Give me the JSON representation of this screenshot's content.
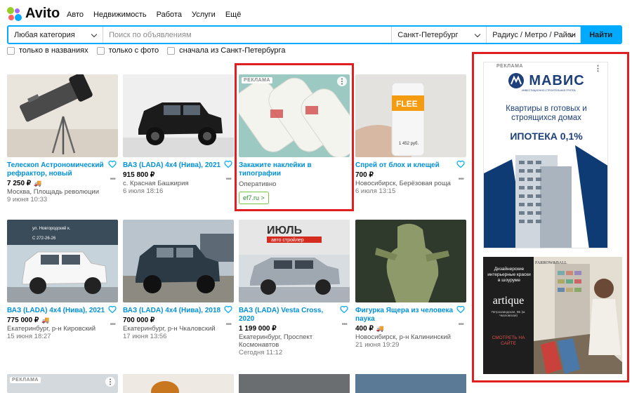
{
  "brand": {
    "name": "Avito"
  },
  "nav": [
    "Авто",
    "Недвижимость",
    "Работа",
    "Услуги",
    "Ещё"
  ],
  "search": {
    "category": "Любая категория",
    "placeholder": "Поиск по объявлениям",
    "city": "Санкт-Петербург",
    "radius": "Радиус / Метро / Район",
    "button": "Найти"
  },
  "filters": [
    "только в названиях",
    "только с фото",
    "сначала из Санкт-Петербурга"
  ],
  "listings": [
    {
      "title": "Телескоп Астрономический рефрактор, новый",
      "price": "7 250 ₽",
      "loc": "Москва, Площадь революции",
      "date": "9 июня 10:33"
    },
    {
      "title": "ВАЗ (LADA) 4x4 (Нива), 2021",
      "price": "915 800 ₽",
      "loc": "с. Красная Башкирия",
      "date": "6 июля 18:16"
    },
    {
      "title": "Спрей от блох и клещей",
      "price": "700 ₽",
      "loc": "Новосибирск, Берёзовая роща",
      "date": "6 июля 13:15"
    },
    {
      "title": "ВАЗ (LADA) 4x4 (Нива), 2021",
      "price": "775 000 ₽",
      "loc": "Екатеринбург, р-н Кировский",
      "date": "15 июня 18:27"
    },
    {
      "title": "ВАЗ (LADA) 4x4 (Нива), 2018",
      "price": "700 000 ₽",
      "loc": "Екатеринбург, р-н Чкаловский",
      "date": "17 июня 13:56"
    },
    {
      "title": "ВАЗ (LADA) Vesta Cross, 2020",
      "price": "1 199 000 ₽",
      "loc": "Екатеринбург, Проспект Космонавтов",
      "date": "Сегодня 11:12"
    },
    {
      "title": "Фигурка Ящера из человека паука",
      "price": "400 ₽",
      "loc": "Новосибирск, р-н Калининский",
      "date": "21 июня 19:29"
    }
  ],
  "ad_inline": {
    "label": "РЕКЛАМА",
    "title": "Закажите наклейки в типографии",
    "subtitle": "Оперативно",
    "link": "ef7.ru >"
  },
  "ad_mavis": {
    "label": "РЕКЛАМА",
    "brand": "МАВИС",
    "tagline": "ИНВЕСТИЦИОННО-СТРОИТЕЛЬНАЯ ГРУППА",
    "text": "Квартиры в готовых и строящихся домах",
    "offer": "ИПОТЕКА 0,1%"
  },
  "ad_artique": {
    "brand_top": "FARROW&BALL",
    "text": "Дизайнерские интерьерные краски в шоуруме",
    "brand": "artique",
    "address": "Петрозаводская, 9Б (м. Чкаловская)",
    "cta": "СМОТРЕТЬ НА САЙТЕ"
  },
  "bottom_label": "РЕКЛАМА",
  "photo_text": {
    "banner1": "ИЮЛЬ",
    "banner2": "авто стройлер",
    "sign1": "ул. Новгородский к.",
    "sign2": "С 272-26-26",
    "plate": "1 452 руб."
  },
  "colors": {
    "accent": "#00aaff",
    "link": "#0091d9",
    "highlight": "#e02020"
  }
}
